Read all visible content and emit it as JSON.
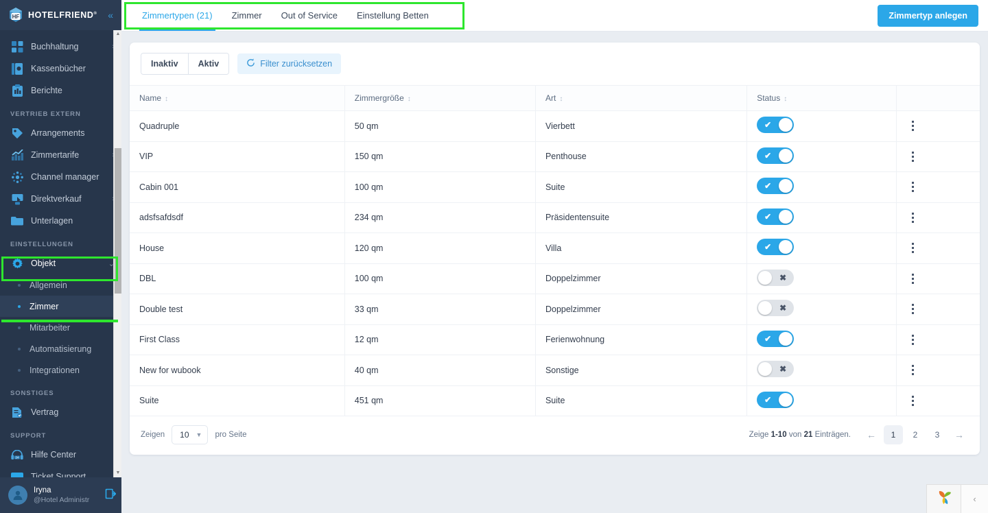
{
  "brand": {
    "name": "HOTELFRIEND",
    "trademark": "®",
    "collapse_icon": "chevrons-left-icon"
  },
  "colors": {
    "accent": "#2ba7e8",
    "sidebar_bg": "#27364b",
    "page_bg": "#e9edf2",
    "highlight": "#2ee62e",
    "toggle_on": "#2ba7e8",
    "toggle_off": "#dfe3e8"
  },
  "sidebar": {
    "items": [
      {
        "label": "Buchhaltung",
        "icon": "calculator-icon",
        "has_arrow": true
      },
      {
        "label": "Kassenbücher",
        "icon": "cashbook-icon",
        "has_arrow": false
      },
      {
        "label": "Berichte",
        "icon": "clipboard-report-icon",
        "has_arrow": false
      }
    ],
    "section_vertrieb": "VERTRIEB EXTERN",
    "vertrieb_items": [
      {
        "label": "Arrangements",
        "icon": "tag-icon",
        "has_arrow": false
      },
      {
        "label": "Zimmertarife",
        "icon": "chart-line-icon",
        "has_arrow": true
      },
      {
        "label": "Channel manager",
        "icon": "network-nodes-icon",
        "has_arrow": false
      },
      {
        "label": "Direktverkauf",
        "icon": "hand-pointer-icon",
        "has_arrow": true
      },
      {
        "label": "Unterlagen",
        "icon": "folder-icon",
        "has_arrow": false
      }
    ],
    "section_einstellungen": "EINSTELLUNGEN",
    "objekt": {
      "label": "Objekt",
      "icon": "gear-icon",
      "expanded": true
    },
    "objekt_children": [
      {
        "label": "Allgemein",
        "active": false
      },
      {
        "label": "Zimmer",
        "active": true
      },
      {
        "label": "Mitarbeiter",
        "active": false
      },
      {
        "label": "Automatisierung",
        "active": false
      },
      {
        "label": "Integrationen",
        "active": false
      }
    ],
    "section_sonstiges": "SONSTIGES",
    "sonstiges_items": [
      {
        "label": "Vertrag",
        "icon": "contract-icon",
        "has_arrow": false
      }
    ],
    "section_support": "SUPPORT",
    "support_items": [
      {
        "label": "Hilfe Center",
        "icon": "headset-24-icon",
        "has_arrow": false
      },
      {
        "label": "Ticket Support",
        "icon": "ticket-icon",
        "has_arrow": false
      }
    ],
    "user": {
      "name": "Iryna",
      "role": "@Hotel Administr",
      "logout_icon": "logout-icon",
      "avatar_icon": "user-avatar-icon"
    }
  },
  "topbar": {
    "tabs": [
      {
        "label": "Zimmertypen (21)",
        "active": true
      },
      {
        "label": "Zimmer",
        "active": false
      },
      {
        "label": "Out of Service",
        "active": false
      },
      {
        "label": "Einstellung Betten",
        "active": false
      }
    ],
    "primary_button": "Zimmertyp anlegen"
  },
  "toolbar": {
    "segment": [
      {
        "label": "Inaktiv",
        "selected": false
      },
      {
        "label": "Aktiv",
        "selected": false
      }
    ],
    "filter_reset": "Filter zurücksetzen",
    "filter_reset_icon": "refresh-icon"
  },
  "table": {
    "columns": [
      {
        "label": "Name",
        "sortable": true
      },
      {
        "label": "Zimmergröße",
        "sortable": true
      },
      {
        "label": "Art",
        "sortable": true
      },
      {
        "label": "Status",
        "sortable": true
      },
      {
        "label": "",
        "sortable": false
      }
    ],
    "rows": [
      {
        "name": "Quadruple",
        "size": "50 qm",
        "art": "Vierbett",
        "status": true
      },
      {
        "name": "VIP",
        "size": "150 qm",
        "art": "Penthouse",
        "status": true
      },
      {
        "name": "Cabin 001",
        "size": "100 qm",
        "art": "Suite",
        "status": true
      },
      {
        "name": "adsfsafdsdf",
        "size": "234 qm",
        "art": "Präsidentensuite",
        "status": true
      },
      {
        "name": "House",
        "size": "120 qm",
        "art": "Villa",
        "status": true
      },
      {
        "name": "DBL",
        "size": "100 qm",
        "art": "Doppelzimmer",
        "status": false
      },
      {
        "name": "Double test",
        "size": "33 qm",
        "art": "Doppelzimmer",
        "status": false
      },
      {
        "name": "First Class",
        "size": "12 qm",
        "art": "Ferienwohnung",
        "status": true
      },
      {
        "name": "New for wubook",
        "size": "40 qm",
        "art": "Sonstige",
        "status": false
      },
      {
        "name": "Suite",
        "size": "451 qm",
        "art": "Suite",
        "status": true
      }
    ],
    "row_menu_icon": "kebab-menu-icon"
  },
  "footer": {
    "show_label": "Zeigen",
    "per_page_value": "10",
    "per_page_label": "pro Seite",
    "info_prefix": "Zeige",
    "info_range": "1-10",
    "info_middle": "von",
    "info_total": "21",
    "info_suffix": "Einträgen.",
    "prev_icon": "arrow-left-icon",
    "next_icon": "arrow-right-icon",
    "pages": [
      "1",
      "2",
      "3"
    ],
    "current_page": "1"
  },
  "chat_widget": {
    "icon": "leaf-chat-icon",
    "collapse_icon": "chevron-left-icon"
  }
}
